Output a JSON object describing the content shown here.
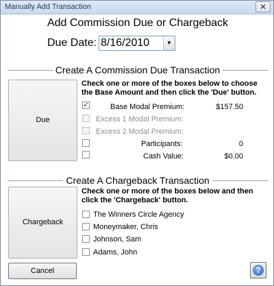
{
  "window": {
    "title": "Manually Add Transaction",
    "close_glyph": "✕"
  },
  "header": {
    "title": "Add Commission Due or Chargeback"
  },
  "due_date": {
    "label": "Due Date:",
    "value": "8/16/2010"
  },
  "commission": {
    "section_title": "Create A Commission Due Transaction",
    "button_label": "Due",
    "instructions": "Check one or more of the boxes below to choose the Base Amount and then click the 'Due' button.",
    "rows": [
      {
        "label": "Base Modal Premium:",
        "value": "$157.50",
        "checked": true,
        "enabled": true
      },
      {
        "label": "Excess 1 Modal Premium:",
        "value": "",
        "checked": false,
        "enabled": false
      },
      {
        "label": "Excess 2 Modal Premium:",
        "value": "",
        "checked": false,
        "enabled": false
      },
      {
        "label": "Participants:",
        "value": "0",
        "checked": false,
        "enabled": true
      },
      {
        "label": "Cash Value:",
        "value": "$0.00",
        "checked": false,
        "enabled": true
      }
    ]
  },
  "chargeback": {
    "section_title": "Create A Chargeback Transaction",
    "button_label": "Chargeback",
    "instructions": "Check one or more of the boxes below and then click the 'Chargeback' button.",
    "items": [
      {
        "label": "The Winners Circle Agency"
      },
      {
        "label": "Moneymaker, Chris"
      },
      {
        "label": "Johnson, Sam"
      },
      {
        "label": "Adams, John"
      }
    ]
  },
  "footer": {
    "cancel_label": "Cancel",
    "help_glyph": "?"
  }
}
